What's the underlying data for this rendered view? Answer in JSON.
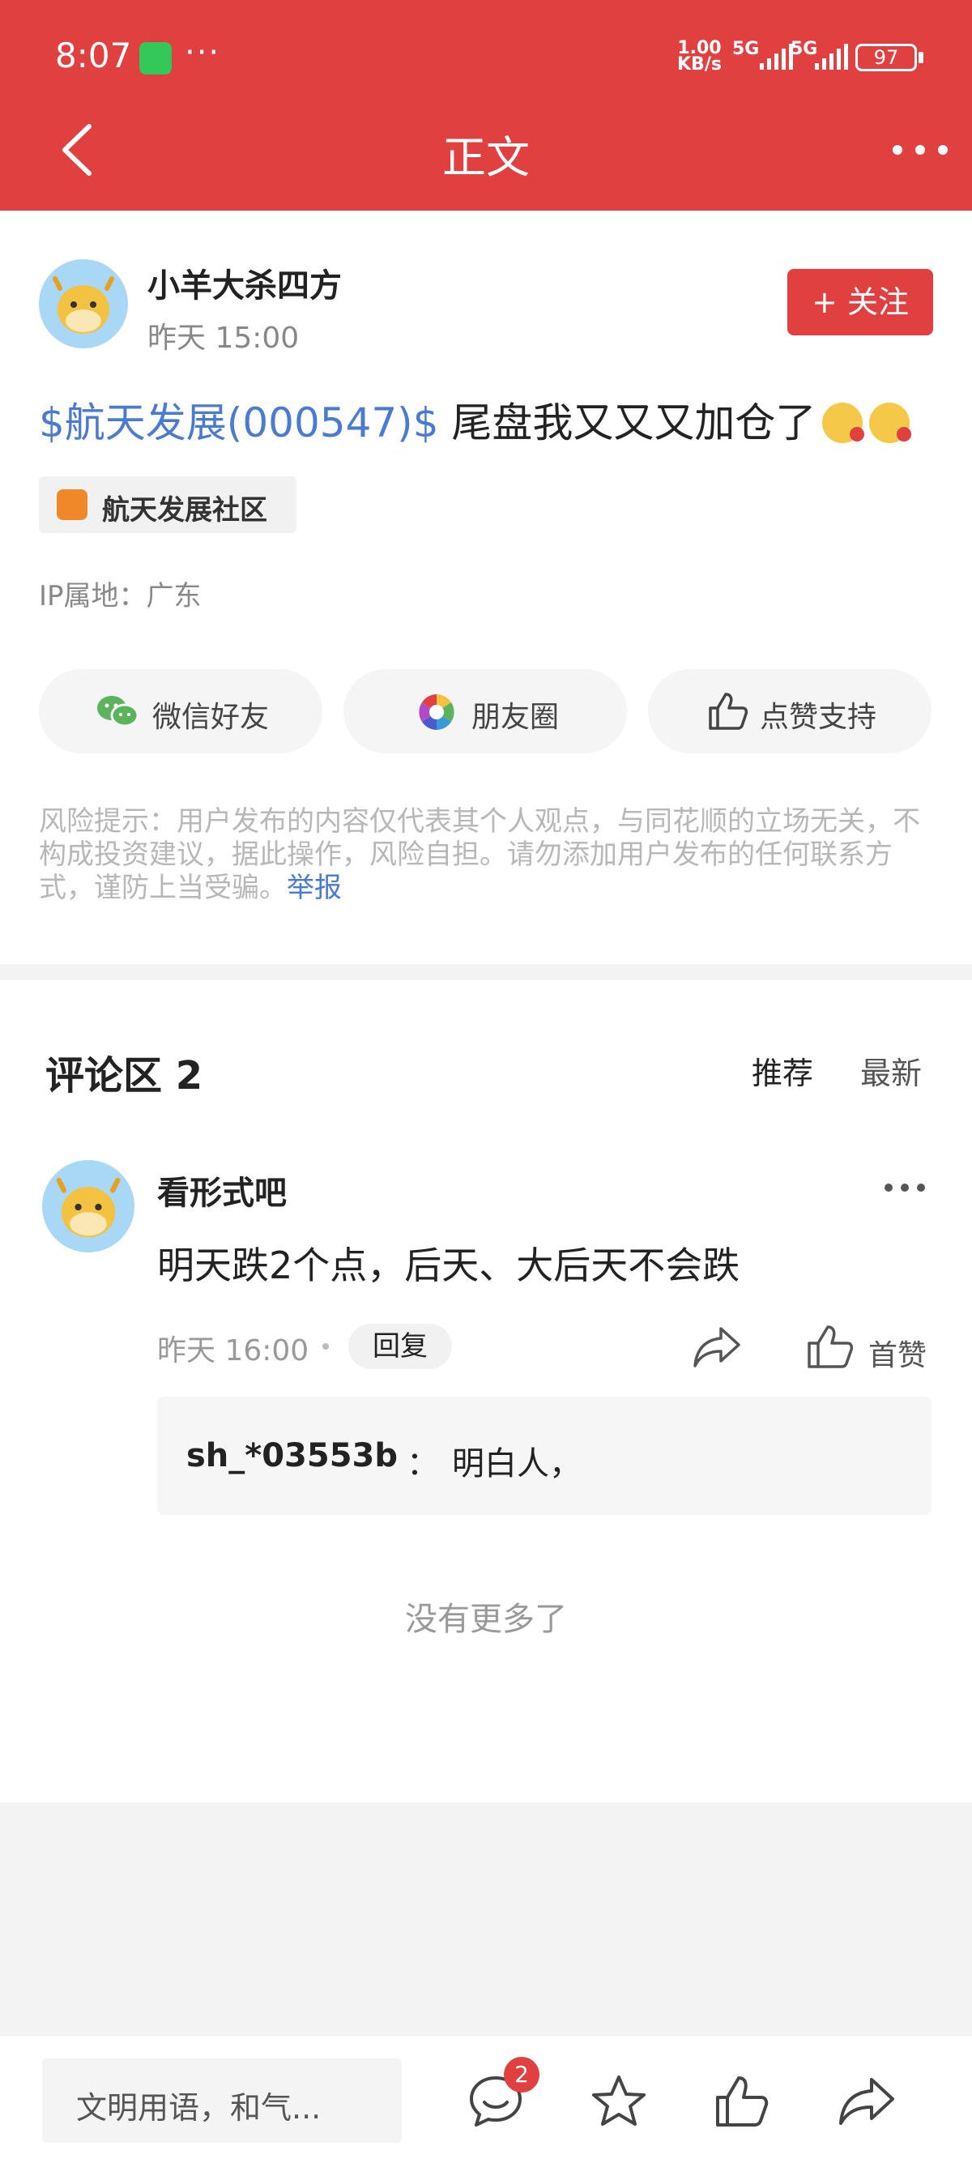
{
  "status_bar": {
    "time": "8:07",
    "more": "···",
    "speed_value": "1.00",
    "speed_unit": "KB/s",
    "net1": "5G",
    "net2": "5G",
    "battery": "97"
  },
  "header": {
    "title": "正文"
  },
  "post": {
    "author": "小羊大杀四方",
    "time": "昨天 15:00",
    "follow_label": "+ 关注",
    "stock_tag": "$航天发展(000547)$",
    "text": " 尾盘我又又又加仓了",
    "community": "航天发展社区",
    "ip": "IP属地：广东",
    "share": {
      "wechat": "微信好友",
      "moments": "朋友圈",
      "like": "点赞支持"
    },
    "risk_text": "风险提示：用户发布的内容仅代表其个人观点，与同花顺的立场无关，不构成投资建议，据此操作，风险自担。请勿添加用户发布的任何联系方式，谨防上当受骗。",
    "report": "举报"
  },
  "comments": {
    "title": "评论区 2",
    "sort_recommended": "推荐",
    "sort_latest": "最新",
    "items": [
      {
        "user": "看形式吧",
        "text": "明天跌2个点，后天、大后天不会跌",
        "time": "昨天 16:00",
        "reply_label": "回复",
        "like_label": "首赞",
        "sub_reply": {
          "user": "sh_*03553b",
          "sep": "：",
          "text": "明白人，"
        }
      }
    ],
    "no_more": "没有更多了"
  },
  "bottom_bar": {
    "input_placeholder": "文明用语，和气...",
    "comment_badge": "2"
  },
  "colors": {
    "brand_red": "#e04040",
    "link_blue": "#4a7bd0"
  }
}
